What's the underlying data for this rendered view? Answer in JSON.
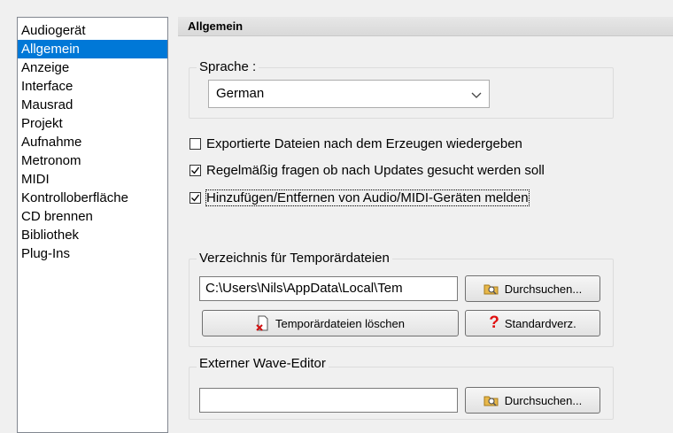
{
  "sidebar": {
    "items": [
      {
        "label": "Audiogerät"
      },
      {
        "label": "Allgemein"
      },
      {
        "label": "Anzeige"
      },
      {
        "label": "Interface"
      },
      {
        "label": "Mausrad"
      },
      {
        "label": "Projekt"
      },
      {
        "label": "Aufnahme"
      },
      {
        "label": "Metronom"
      },
      {
        "label": "MIDI"
      },
      {
        "label": "Kontrolloberfläche"
      },
      {
        "label": "CD brennen"
      },
      {
        "label": "Bibliothek"
      },
      {
        "label": "Plug-Ins"
      }
    ],
    "selected": "Allgemein"
  },
  "panel": {
    "title": "Allgemein",
    "language": {
      "label": "Sprache :",
      "value": "German"
    },
    "checkboxes": [
      {
        "label": "Exportierte Dateien nach dem Erzeugen wiedergeben",
        "checked": false
      },
      {
        "label": "Regelmäßig fragen ob nach Updates gesucht werden soll",
        "checked": true
      },
      {
        "label": "Hinzufügen/Entfernen von Audio/MIDI-Geräten melden",
        "checked": true
      }
    ],
    "temp": {
      "label": "Verzeichnis für Temporärdateien",
      "path": "C:\\Users\\Nils\\AppData\\Local\\Tem",
      "browse_label": "Durchsuchen...",
      "delete_label": "Temporärdateien löschen",
      "default_label": "Standardverz."
    },
    "wave_editor": {
      "label": "Externer Wave-Editor",
      "path": "",
      "browse_label": "Durchsuchen..."
    }
  },
  "colors": {
    "selection": "#0078d7",
    "background": "#f0f0f0"
  }
}
